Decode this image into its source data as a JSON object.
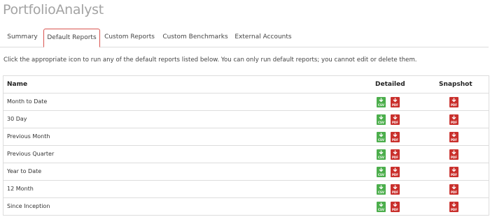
{
  "app": {
    "title": "PortfolioAnalyst"
  },
  "tabs": [
    {
      "label": "Summary",
      "active": false
    },
    {
      "label": "Default Reports",
      "active": true
    },
    {
      "label": "Custom Reports",
      "active": false
    },
    {
      "label": "Custom Benchmarks",
      "active": false
    },
    {
      "label": "External Accounts",
      "active": false
    }
  ],
  "intro_text": "Click the appropriate icon to run any of the default reports listed below. You can only run default reports; you cannot edit or delete them.",
  "table": {
    "headers": {
      "name": "Name",
      "detailed": "Detailed",
      "snapshot": "Snapshot"
    },
    "rows": [
      {
        "name": "Month to Date"
      },
      {
        "name": "30 Day"
      },
      {
        "name": "Previous Month"
      },
      {
        "name": "Previous Quarter"
      },
      {
        "name": "Year to Date"
      },
      {
        "name": "12 Month"
      },
      {
        "name": "Since Inception"
      }
    ]
  },
  "icons": {
    "csv_label": "CSV",
    "pdf_label": "PDF",
    "csv_color": "#4cae4c",
    "pdf_color": "#c9302c"
  },
  "colors": {
    "active_tab_border": "#d9534f"
  }
}
